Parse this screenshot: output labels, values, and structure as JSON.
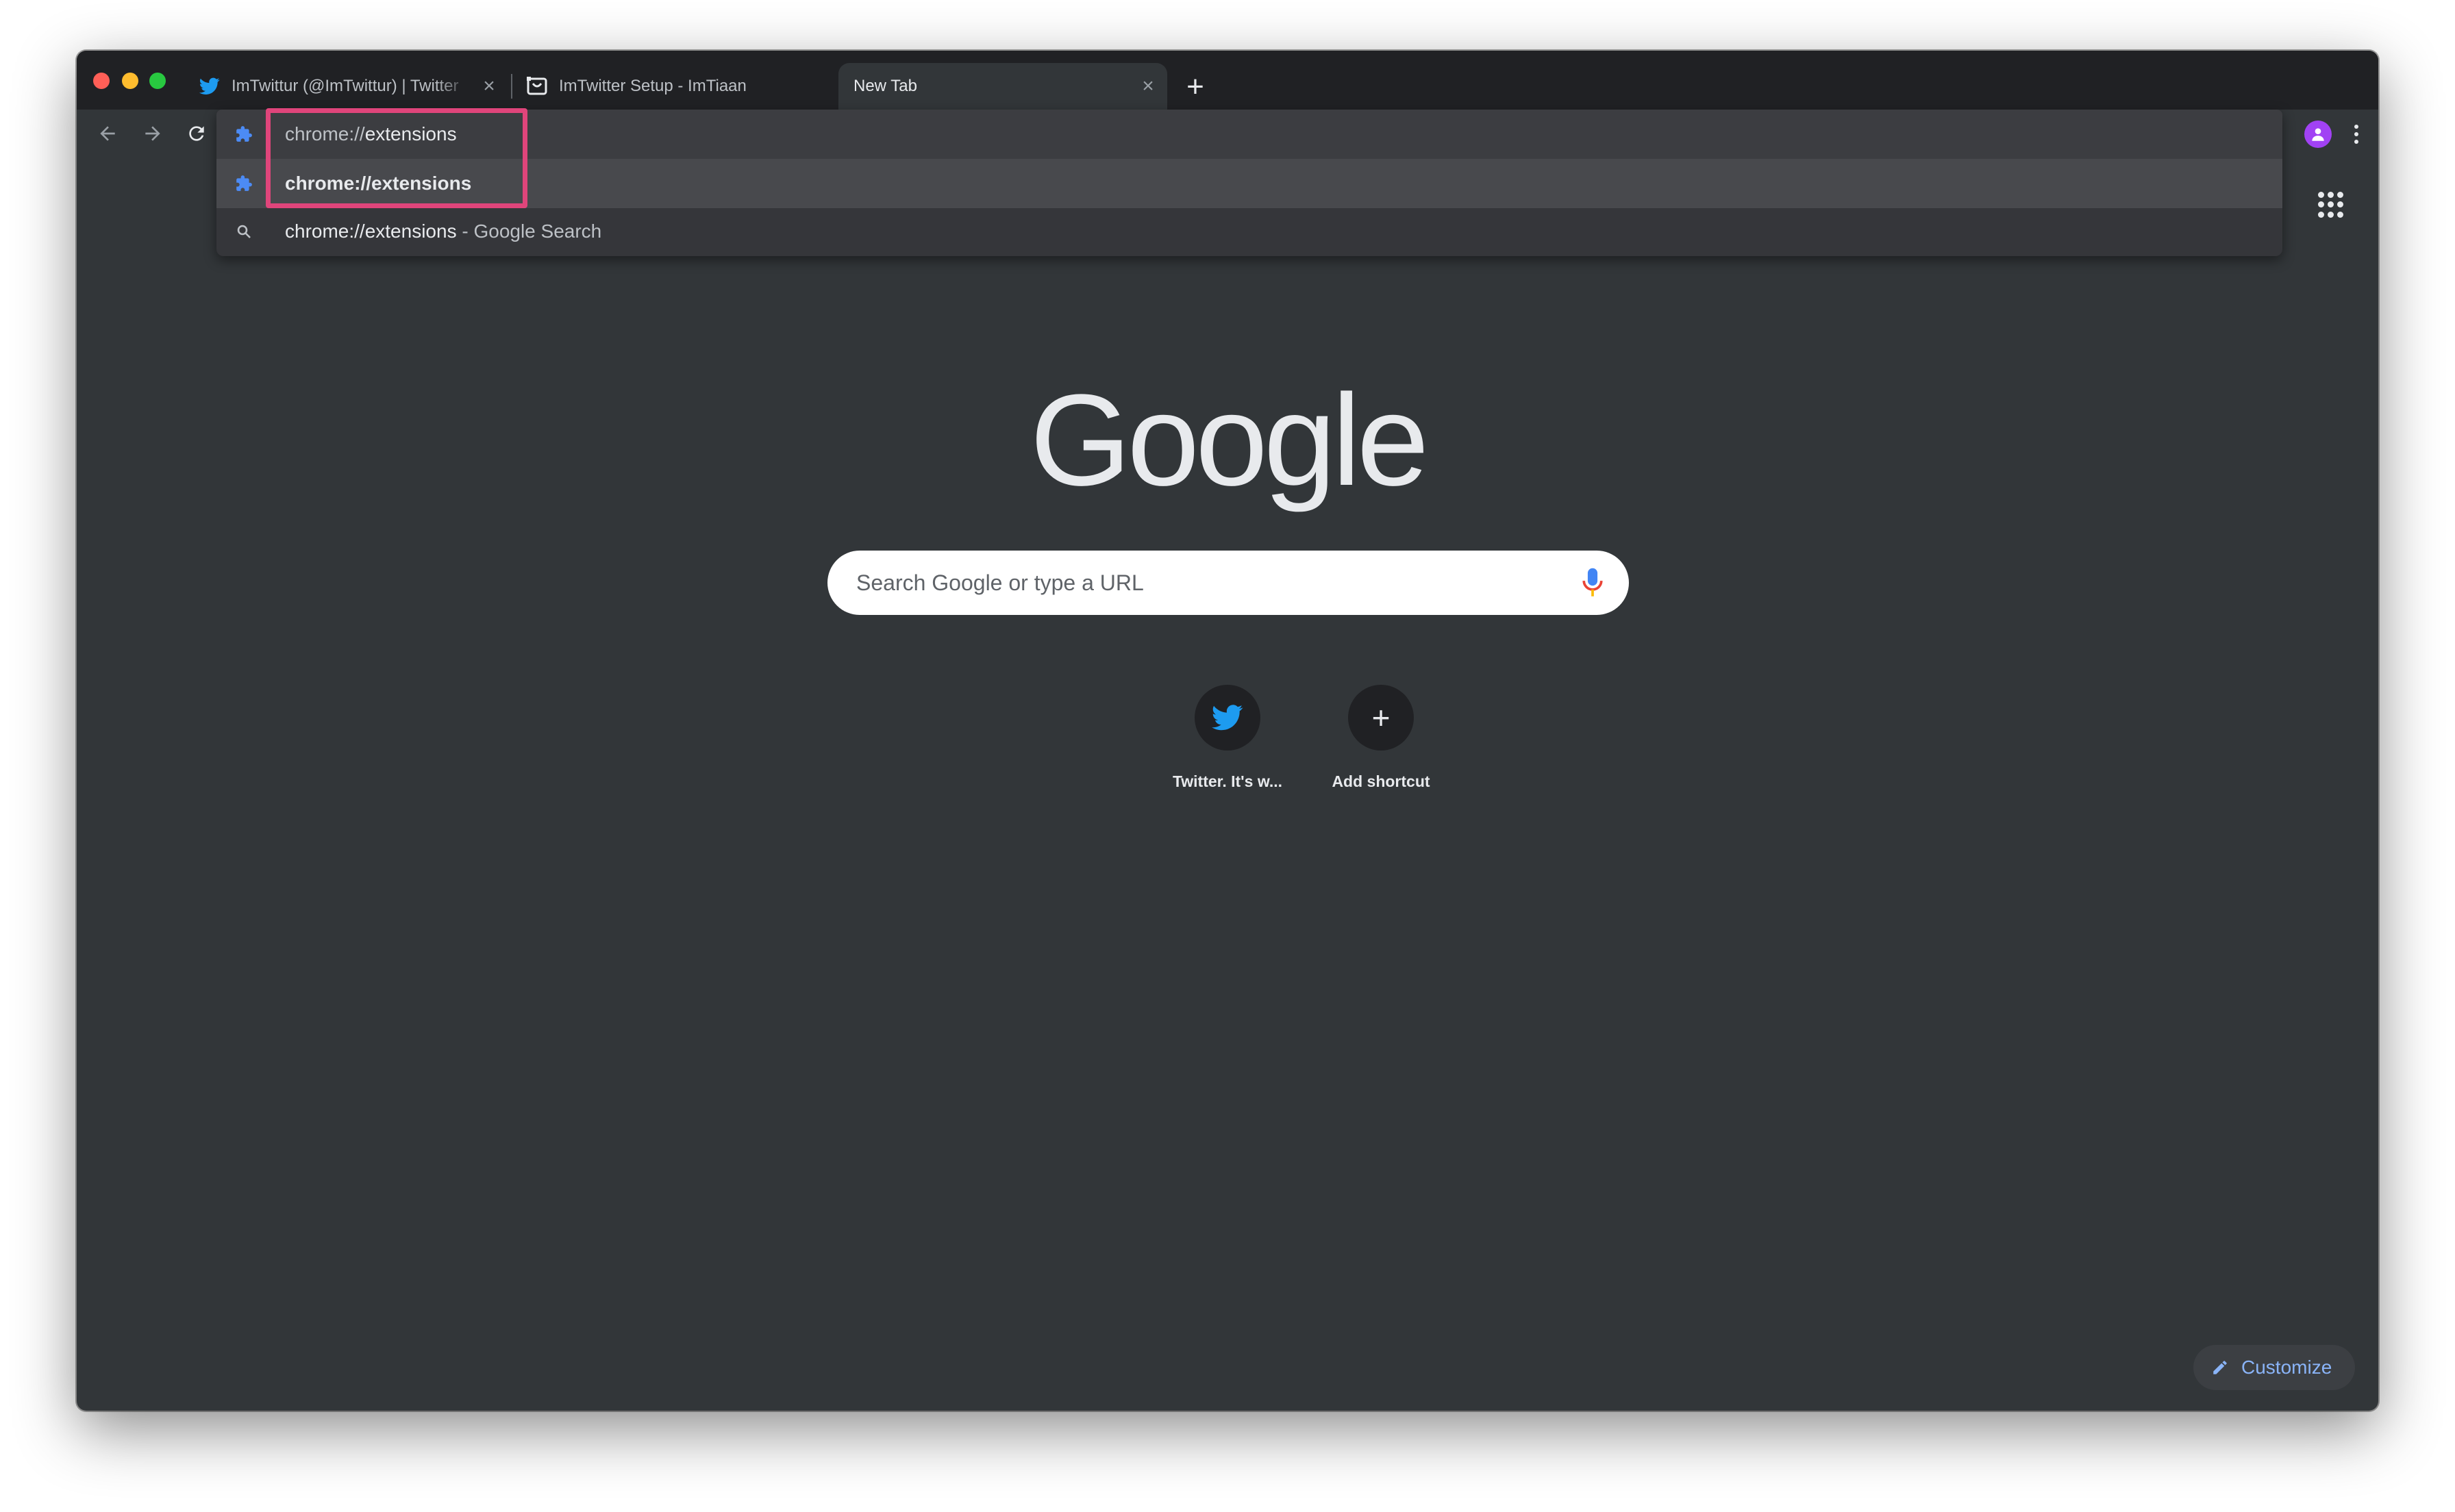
{
  "tabs": [
    {
      "title": "ImTwittur (@ImTwittur) | Twitter",
      "icon": "twitter-bird-icon"
    },
    {
      "title": "ImTwitter Setup - ImTiaan",
      "icon": "app-window-icon"
    },
    {
      "title": "New Tab",
      "icon": ""
    }
  ],
  "tab_close_glyph": "×",
  "new_tab_glyph": "+",
  "omnibox": {
    "input_prefix": "chrome://",
    "input_suffix": "extensions",
    "suggestions": [
      {
        "text": "chrome://extensions",
        "icon": "extension-puzzle-icon"
      },
      {
        "text": "chrome://extensions",
        "suffix": " - Google Search",
        "icon": "search-icon"
      }
    ]
  },
  "page": {
    "logo": "Google",
    "search_placeholder": "Search Google or type a URL",
    "shortcuts": [
      {
        "label": "Twitter. It's w...",
        "icon": "twitter-bird-icon"
      },
      {
        "label": "Add shortcut",
        "icon": "plus-icon",
        "glyph": "+"
      }
    ],
    "customize_label": "Customize"
  },
  "colors": {
    "frame": "#202124",
    "toolbar": "#323639",
    "accent_blue": "#8ab4f8",
    "highlight": "#e0457b",
    "twitter_blue": "#1d9bf0"
  }
}
